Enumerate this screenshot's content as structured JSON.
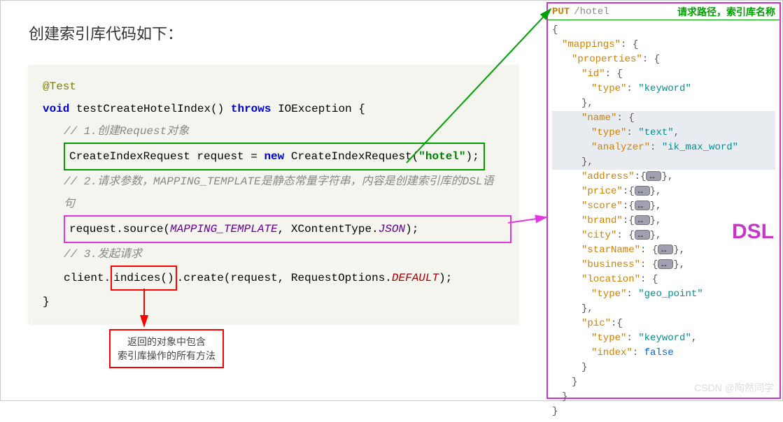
{
  "title": "创建索引库代码如下：",
  "code": {
    "annotation": "@Test",
    "voidKw": "void",
    "method": "testCreateHotelIndex()",
    "throwsKw": "throws",
    "exception": "IOException {",
    "comment1": "// 1.创建Request对象",
    "line2_a": "CreateIndexRequest request = ",
    "line2_new": "new",
    "line2_b": " CreateIndexRequest(",
    "line2_str": "\"hotel\"",
    "line2_c": ");",
    "comment2": "// 2.请求参数，MAPPING_TEMPLATE是静态常量字符串，内容是创建索引库的DSL语句",
    "line4_a": "request.source(",
    "line4_tpl": "MAPPING_TEMPLATE",
    "line4_b": ", XContentType.",
    "line4_json": "JSON",
    "line4_c": ");",
    "comment3": "// 3.发起请求",
    "line6_a": "client.",
    "line6_ind": "indices()",
    "line6_b": ".create(request, RequestOptions.",
    "line6_def": "DEFAULT",
    "line6_c": ");",
    "closeBrace": "}"
  },
  "callout": {
    "l1": "返回的对象中包含",
    "l2": "索引库操作的所有方法"
  },
  "right": {
    "put": "PUT",
    "path": "/hotel",
    "headerNote": "请求路径，索引库名称",
    "dslLabel": "DSL",
    "json": {
      "mappings": "\"mappings\"",
      "properties": "\"properties\"",
      "id": "\"id\"",
      "type": "\"type\"",
      "keyword": "\"keyword\"",
      "name": "\"name\"",
      "text": "\"text\"",
      "analyzer": "\"analyzer\"",
      "ik": "\"ik_max_word\"",
      "address": "\"address\"",
      "price": "\"price\"",
      "score": "\"score\"",
      "brand": "\"brand\"",
      "city": "\"city\"",
      "starName": "\"starName\"",
      "business": "\"business\"",
      "location": "\"location\"",
      "geo": "\"geo_point\"",
      "pic": "\"pic\"",
      "index": "\"index\"",
      "falseVal": "false"
    }
  },
  "watermark": "CSDN @陶然同学"
}
